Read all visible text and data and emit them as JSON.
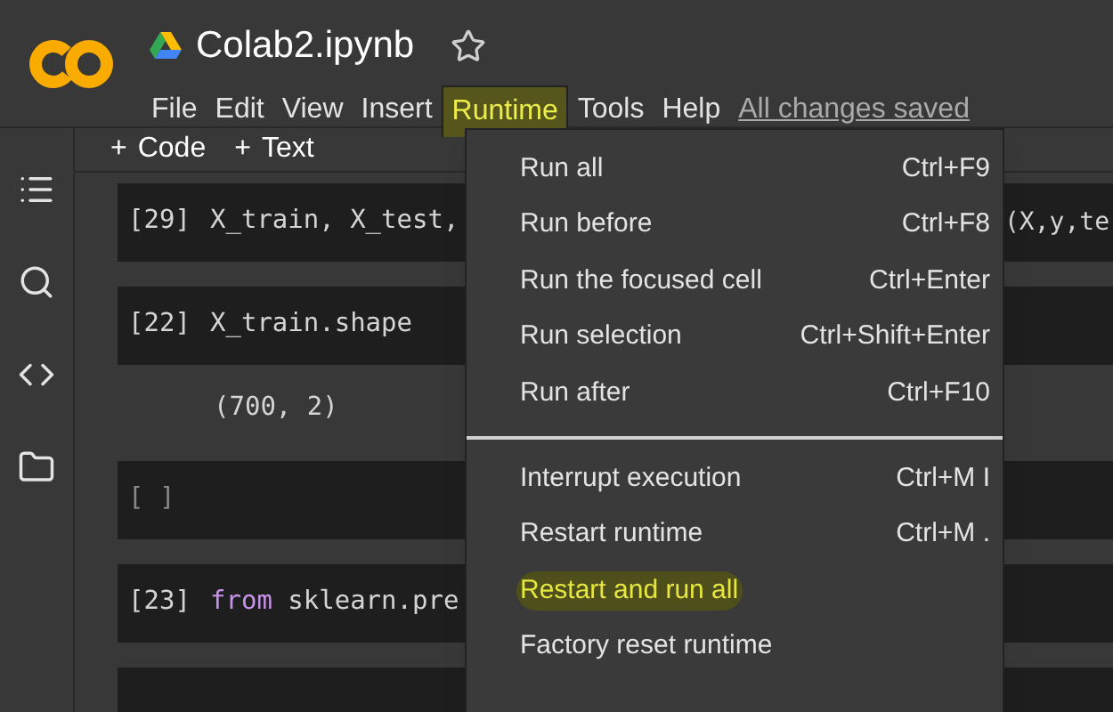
{
  "header": {
    "title": "Colab2.ipynb",
    "menu": [
      {
        "label": "File",
        "highlighted": false
      },
      {
        "label": "Edit",
        "highlighted": false
      },
      {
        "label": "View",
        "highlighted": false
      },
      {
        "label": "Insert",
        "highlighted": false
      },
      {
        "label": "Runtime",
        "highlighted": true
      },
      {
        "label": "Tools",
        "highlighted": false
      },
      {
        "label": "Help",
        "highlighted": false
      }
    ],
    "save_status": "All changes saved"
  },
  "toolbar": {
    "buttons": [
      {
        "symbol": "+",
        "label": "Code"
      },
      {
        "symbol": "+",
        "label": "Text"
      }
    ]
  },
  "cells": [
    {
      "kind": "code",
      "prompt": "[29]",
      "left": [
        {
          "kind": "plain",
          "text": "X_train, X_test,"
        }
      ],
      "right": [
        {
          "kind": "plain",
          "text": "(X,y,te"
        }
      ]
    },
    {
      "kind": "code",
      "prompt": "[22]",
      "left": [
        {
          "kind": "plain",
          "text": "X_train.shape"
        }
      ],
      "output": "(700, 2)"
    },
    {
      "kind": "empty",
      "prompt": "[ ]"
    },
    {
      "kind": "code",
      "prompt": "[23]",
      "left": [
        {
          "kind": "keyword",
          "text": "from"
        },
        {
          "kind": "plain",
          "text": " sklearn.pre"
        }
      ]
    },
    {
      "kind": "code"
    }
  ],
  "runtime_menu": {
    "groups": [
      [
        {
          "label": "Run all",
          "shortcut": "Ctrl+F9",
          "highlighted": false
        },
        {
          "label": "Run before",
          "shortcut": "Ctrl+F8",
          "highlighted": false
        },
        {
          "label": "Run the focused cell",
          "shortcut": "Ctrl+Enter",
          "highlighted": false
        },
        {
          "label": "Run selection",
          "shortcut": "Ctrl+Shift+Enter",
          "highlighted": false
        },
        {
          "label": "Run after",
          "shortcut": "Ctrl+F10",
          "highlighted": false
        }
      ],
      [
        {
          "label": "Interrupt execution",
          "shortcut": "Ctrl+M I",
          "highlighted": false
        },
        {
          "label": "Restart runtime",
          "shortcut": "Ctrl+M .",
          "highlighted": false
        },
        {
          "label": "Restart and run all",
          "highlighted": true
        },
        {
          "label": "Factory reset runtime",
          "highlighted": false
        }
      ]
    ]
  }
}
